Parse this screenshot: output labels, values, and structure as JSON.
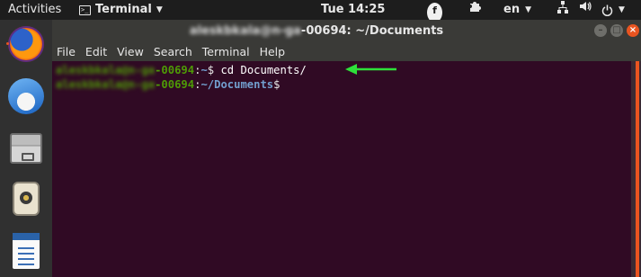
{
  "topbar": {
    "activities": "Activities",
    "app_name": "Terminal",
    "clock": "Tue 14:25",
    "tray_icon_letter": "f",
    "language": "en"
  },
  "dock": {
    "items": [
      "firefox-icon",
      "thunderbird-icon",
      "files-icon",
      "rhythmbox-icon",
      "libreoffice-writer-icon"
    ]
  },
  "window": {
    "title_user_blurred": "aleskbkala@n-ga",
    "title_suffix": "-00694: ~/Documents",
    "menu": [
      "File",
      "Edit",
      "View",
      "Search",
      "Terminal",
      "Help"
    ]
  },
  "terminal": {
    "line1": {
      "user_blurred": "aleskbkala@n-ga",
      "host_suffix": "-00694",
      "sep": ":",
      "path": "~",
      "prompt": "$ ",
      "command": "cd Documents/"
    },
    "line2": {
      "user_blurred": "aleskbkala@n-ga",
      "host_suffix": "-00694",
      "sep": ":",
      "path": "~/Documents",
      "prompt": "$"
    }
  },
  "colors": {
    "terminal_bg": "#300a24",
    "prompt_user": "#4e9a06",
    "prompt_path": "#729fcf",
    "accent": "#e95420",
    "annotation_arrow": "#2ee03a"
  }
}
